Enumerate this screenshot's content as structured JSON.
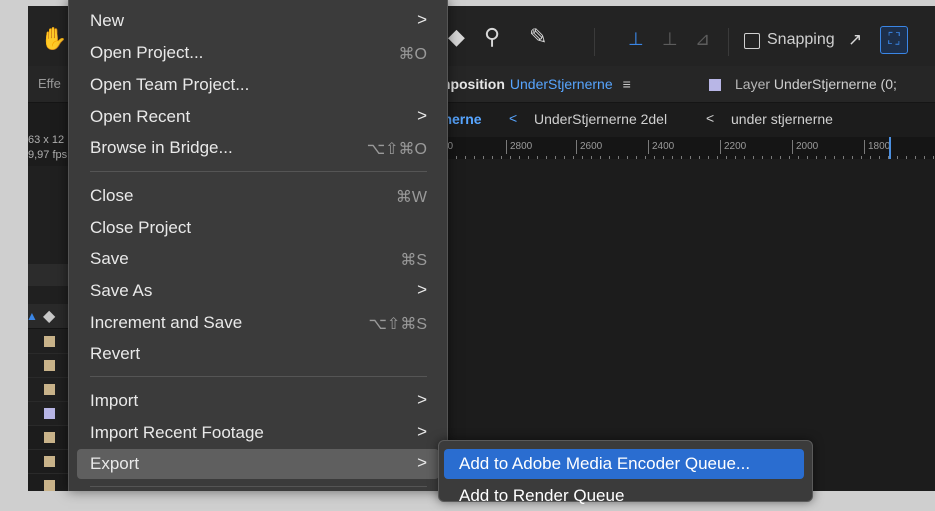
{
  "toolbar": {
    "icons": [
      "hand-icon",
      "puppet-pin-icon",
      "pin-icon",
      "axis-local-icon",
      "axis-world-icon",
      "axis-view-icon"
    ],
    "snapping_label": "Snapping",
    "snapping_checked": false
  },
  "panels": {
    "effects_tab_label": "Effe",
    "composition_tab": {
      "prefix": "mposition",
      "name": "UnderStjernerne",
      "menu_icon": "≡"
    },
    "layer_tab": {
      "prefix": "Layer",
      "name": "UnderStjernerne (0;",
      "swatch_color": "#b8b6e6"
    }
  },
  "breadcrumbs": {
    "items": [
      "rnerne",
      "UnderStjernerne 2del",
      "under stjernerne"
    ],
    "separator": "<"
  },
  "comp_info": {
    "size": "63 x 12",
    "fps": "9,97 fps"
  },
  "ruler": {
    "ticks": [
      "00",
      "2800",
      "2600",
      "2400",
      "2200",
      "2000",
      "1800"
    ]
  },
  "layer_swatches": [
    "#c9b38a",
    "#c9b38a",
    "#c9b38a",
    "#b8b6e6",
    "#c9b38a",
    "#c9b38a",
    "#c9b38a"
  ],
  "file_menu": {
    "items": [
      {
        "label": "New",
        "shortcut": "",
        "submenu": true
      },
      {
        "label": "Open Project...",
        "shortcut": "⌘O",
        "submenu": false
      },
      {
        "label": "Open Team Project...",
        "shortcut": "",
        "submenu": false
      },
      {
        "label": "Open Recent",
        "shortcut": "",
        "submenu": true
      },
      {
        "label": "Browse in Bridge...",
        "shortcut": "⌥⇧⌘O",
        "submenu": false
      },
      {
        "label": "Close",
        "shortcut": "⌘W",
        "submenu": false
      },
      {
        "label": "Close Project",
        "shortcut": "",
        "submenu": false
      },
      {
        "label": "Save",
        "shortcut": "⌘S",
        "submenu": false
      },
      {
        "label": "Save As",
        "shortcut": "",
        "submenu": true
      },
      {
        "label": "Increment and Save",
        "shortcut": "⌥⇧⌘S",
        "submenu": false
      },
      {
        "label": "Revert",
        "shortcut": "",
        "submenu": false
      },
      {
        "label": "Import",
        "shortcut": "",
        "submenu": true
      },
      {
        "label": "Import Recent Footage",
        "shortcut": "",
        "submenu": true
      },
      {
        "label": "Export",
        "shortcut": "",
        "submenu": true,
        "highlighted": true
      }
    ],
    "submenu_arrow": ">"
  },
  "export_submenu": {
    "items": [
      {
        "label": "Add to Adobe Media Encoder Queue...",
        "highlighted": true
      },
      {
        "label": "Add to Render Queue",
        "highlighted": false
      }
    ]
  },
  "colors": {
    "accent": "#57a5ff",
    "highlight": "#2a6dd0",
    "menu_bg": "#3b3b3b",
    "menu_hover": "#5f5f5f"
  }
}
